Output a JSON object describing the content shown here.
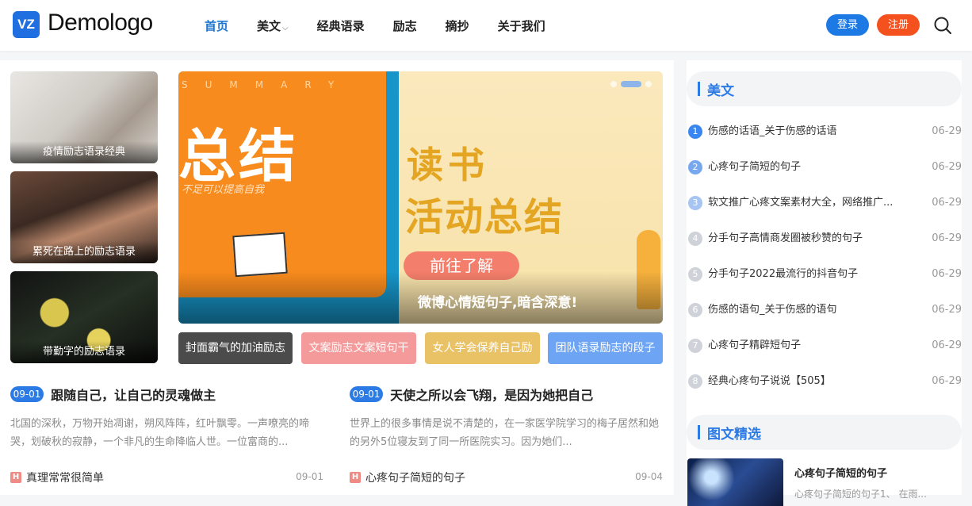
{
  "brand": {
    "logo_mark": "VZ",
    "logo_text": "Demologo"
  },
  "nav": [
    {
      "label": "首页",
      "active": true
    },
    {
      "label": "美文",
      "has_dropdown": true
    },
    {
      "label": "经典语录"
    },
    {
      "label": "励志"
    },
    {
      "label": "摘抄"
    },
    {
      "label": "关于我们"
    }
  ],
  "nav_caret": "⌵",
  "auth": {
    "login": "登录",
    "register": "注册"
  },
  "thumbs": [
    {
      "caption": "疫情励志语录经典"
    },
    {
      "caption": "累死在路上的励志语录"
    },
    {
      "caption": "带勤字的励志语录"
    }
  ],
  "banner": {
    "summary": "SUMMARY",
    "big_text": "总结",
    "sub_text": "不足可以提高自我",
    "line1": "读书",
    "line2": "活动总结",
    "button": "前往了解",
    "caption": "微博心情短句子,暗含深意!"
  },
  "tags": [
    "封面霸气的加油励志",
    "文案励志文案短句干",
    "女人学会保养自己励",
    "团队语录励志的段子"
  ],
  "posts": [
    {
      "date": "09-01",
      "title": "跟随自己，让自己的灵魂做主",
      "excerpt": "北国的深秋，万物开始凋谢，朔风阵阵，红叶飘零。一声嘹亮的啼哭，划破秋的寂静，一个非凡的生命降临人世。一位富商的..."
    },
    {
      "date": "09-01",
      "title": "天使之所以会飞翔，是因为她把自己",
      "excerpt": "世界上的很多事情是说不清楚的，在一家医学院学习的梅子居然和她的另外5位寝友到了同一所医院实习。因为她们..."
    }
  ],
  "mini_posts": [
    {
      "icon": "H",
      "title": "真理常常很简单",
      "date": "09-01"
    },
    {
      "icon": "H",
      "title": "心疼句子简短的句子",
      "date": "09-04"
    }
  ],
  "sidebar": {
    "section1": "美文",
    "rank_colors": [
      "#3a86f0",
      "#76a7ef",
      "#a7c5f2",
      "#cfd3d9"
    ],
    "ranks": [
      {
        "num": "1",
        "title": "伤感的话语_关于伤感的话语",
        "date": "06-29"
      },
      {
        "num": "2",
        "title": "心疼句子简短的句子",
        "date": "06-29"
      },
      {
        "num": "3",
        "title": "软文推广心疼文案素材大全，网络推广...",
        "date": "06-29"
      },
      {
        "num": "4",
        "title": "分手句子高情商发圈被秒赞的句子",
        "date": "06-29"
      },
      {
        "num": "5",
        "title": "分手句子2022最流行的抖音句子",
        "date": "06-29"
      },
      {
        "num": "6",
        "title": "伤感的语句_关于伤感的语句",
        "date": "06-29"
      },
      {
        "num": "7",
        "title": "心疼句子精辟短句子",
        "date": "06-29"
      },
      {
        "num": "8",
        "title": "经典心疼句子说说【505】",
        "date": "06-29"
      }
    ],
    "section2": "图文精选",
    "featured": {
      "title": "心疼句子简短的句子",
      "sub": "心疼句子简短的句子1、 在雨..."
    }
  }
}
